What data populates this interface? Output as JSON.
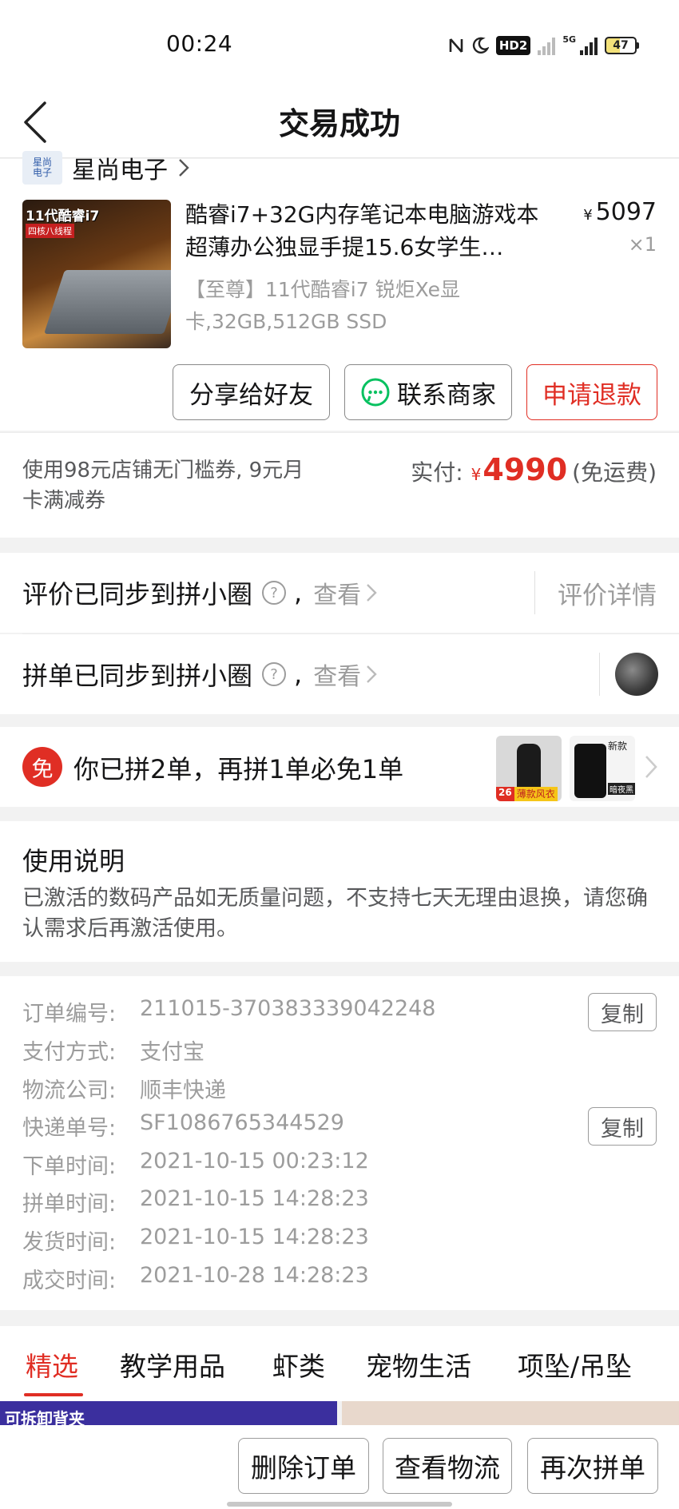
{
  "status_bar": {
    "time": "00:24",
    "hd_label": "HD2",
    "network_label": "5G",
    "battery": "47",
    "battery_level": 0.47
  },
  "nav": {
    "title": "交易成功"
  },
  "store": {
    "name": "星尚电子"
  },
  "product": {
    "thumb_badge": "11代酷睿i7",
    "thumb_sub": "四核八线程",
    "title": "酷睿i7+32G内存笔记本电脑游戏本超薄办公独显手提15.6女学生…",
    "currency": "¥",
    "price": "5097",
    "quantity": "×1",
    "spec": "【至尊】11代酷睿i7 锐炬Xe显卡,32GB,512GB SSD"
  },
  "actions": {
    "share": "分享给好友",
    "contact": "联系商家",
    "refund": "申请退款"
  },
  "payment": {
    "promo": "使用98元店铺无门槛券, 9元月卡满减券",
    "paid_label": "实付:",
    "currency": "¥",
    "amount": "4990",
    "shipping": "(免运费)"
  },
  "sync": {
    "review_label": "评价已同步到拼小圈",
    "group_label": "拼单已同步到拼小圈",
    "comma": ",",
    "view_label": "查看",
    "review_detail": "评价详情"
  },
  "free_order": {
    "badge": "免",
    "text": "你已拼2单，再拼1单必免1单",
    "thumb1_count": "26",
    "thumb1_tag": "薄款风衣",
    "thumb2_text": "新款",
    "thumb2_label": "暗夜黑"
  },
  "usage": {
    "title": "使用说明",
    "body": "已激活的数码产品如无质量问题，不支持七天无理由退换，请您确认需求后再激活使用。"
  },
  "order_info": {
    "copy_label": "复制",
    "rows": [
      {
        "key": "订单编号:",
        "value": "211015-370383339042248"
      },
      {
        "key": "支付方式:",
        "value": "支付宝"
      },
      {
        "key": "物流公司:",
        "value": "顺丰快递"
      },
      {
        "key": "快递单号:",
        "value": "SF1086765344529"
      },
      {
        "key": "下单时间:",
        "value": "2021-10-15 00:23:12"
      },
      {
        "key": "拼单时间:",
        "value": "2021-10-15 14:28:23"
      },
      {
        "key": "发货时间:",
        "value": "2021-10-15 14:28:23"
      },
      {
        "key": "成交时间:",
        "value": "2021-10-28 14:28:23"
      }
    ]
  },
  "tabs": [
    "精选",
    "教学用品",
    "虾类",
    "宠物生活",
    "项坠/吊坠"
  ],
  "feed": {
    "banner_text": "可拆卸背夹"
  },
  "bottom": {
    "delete": "删除订单",
    "logistics": "查看物流",
    "reorder": "再次拼单"
  },
  "colors": {
    "accent": "#e02e24",
    "text": "#151516",
    "muted": "#9c9c9c",
    "wechat_green": "#07c160"
  }
}
